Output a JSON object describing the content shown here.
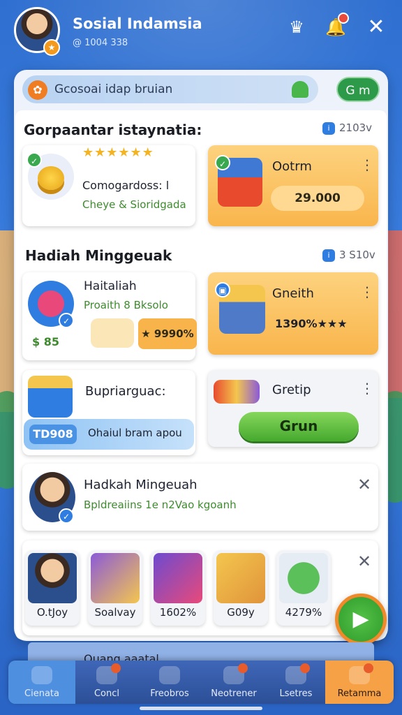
{
  "header": {
    "app_title": "Sosial Indamsia",
    "subtitle": "@ 1004 338",
    "icons": [
      "crown-icon",
      "bell-icon",
      "close-icon"
    ]
  },
  "search": {
    "text": "Gcosoai idap bruian",
    "go_label": "G m"
  },
  "section1": {
    "title": "Gorpaantar istaynatia:",
    "meta": "2103v",
    "card_left": {
      "line1": "Comogardoss: l",
      "line2": "Cheye & Sioridgada",
      "rating": "★★★★★★"
    },
    "card_right": {
      "title": "Ootrm",
      "value": "29.000"
    }
  },
  "section2": {
    "title": "Hadiah Minggeuak",
    "meta": "3 S10v",
    "card_left": {
      "title": "Haitaliah",
      "line2": "Proaith 8 Bksolo",
      "price_left": "$ 85",
      "price_right": "★ 9990%"
    },
    "card_right": {
      "title": "Gneith",
      "value": "1390%★★★"
    }
  },
  "section3": {
    "card_left": {
      "title": "Bupriarguac:",
      "tag": "TD908",
      "strip_text": "Ohaiul bram apou"
    },
    "card_right": {
      "title": "Gretip",
      "button_label": "Grun"
    }
  },
  "section4": {
    "title": "Hadkah Mingeuah",
    "subtitle": "Bpldreaiins 1e n2Vao kgoanh"
  },
  "thumbs": [
    {
      "label": "O.tJoy"
    },
    {
      "label": "Soalvay"
    },
    {
      "label": "1602%"
    },
    {
      "label": "G09y"
    },
    {
      "label": "4279%"
    }
  ],
  "peek_text": "Ouang aaatal",
  "nav": [
    {
      "label": "Cienata"
    },
    {
      "label": "Concl"
    },
    {
      "label": "Freobros"
    },
    {
      "label": "Neotrener"
    },
    {
      "label": "Lsetres"
    },
    {
      "label": "Retamma"
    }
  ],
  "colors": {
    "primary_blue": "#2f6fd0",
    "accent_orange": "#f9b54c",
    "accent_green": "#45a92e"
  }
}
